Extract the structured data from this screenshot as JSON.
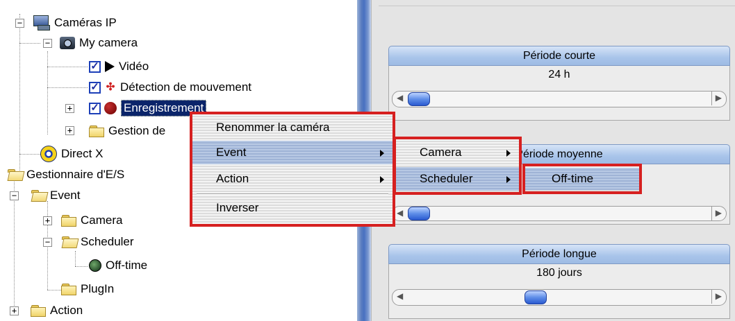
{
  "tree": {
    "ip_cameras": "Caméras IP",
    "my_camera": "My camera",
    "video": "Vidéo",
    "motion": "Détection de mouvement",
    "recording": "Enregistrement",
    "management": "Gestion de",
    "directx": "Direct X",
    "io_manager": "Gestionnaire d'E/S",
    "event": "Event",
    "camera": "Camera",
    "scheduler": "Scheduler",
    "offtime": "Off-time",
    "plugin": "PlugIn",
    "action": "Action"
  },
  "panel": {
    "short_period": {
      "title": "Période courte",
      "value": "24 h",
      "position": 0.0
    },
    "medium_period": {
      "title": "Période moyenne"
    },
    "long_period": {
      "title": "Période longue",
      "value": "180 jours",
      "position": 0.42
    }
  },
  "context_menu": {
    "rename": "Renommer la caméra",
    "event": "Event",
    "action": "Action",
    "invert": "Inverser"
  },
  "event_submenu": {
    "camera": "Camera",
    "scheduler": "Scheduler"
  },
  "scheduler_submenu": {
    "offtime": "Off-time"
  },
  "colors": {
    "highlight_border": "#d62020",
    "selection": "#0a246a",
    "splitter": "#4870c0"
  }
}
